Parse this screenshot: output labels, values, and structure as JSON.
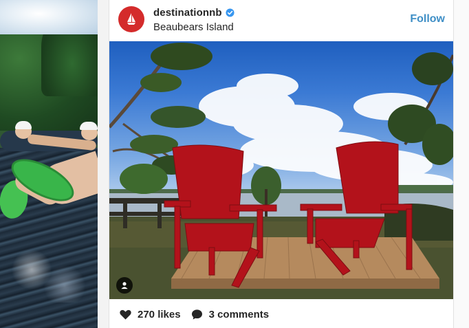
{
  "post": {
    "username": "destinationnb",
    "verified": true,
    "location": "Beaubears Island",
    "follow_label": "Follow",
    "likes_label": "270 likes",
    "comments_label": "3 comments"
  },
  "icons": {
    "avatar": "sailboat-logo-icon",
    "verified": "verified-badge-icon",
    "user_tag": "user-tag-icon",
    "likes": "heart-icon",
    "comments": "comment-bubble-icon"
  },
  "colors": {
    "accent": "#3f8fc6",
    "avatar_bg": "#d42b2b",
    "verified": "#3897f0",
    "chairs": "#b3121b",
    "text": "#262626"
  }
}
